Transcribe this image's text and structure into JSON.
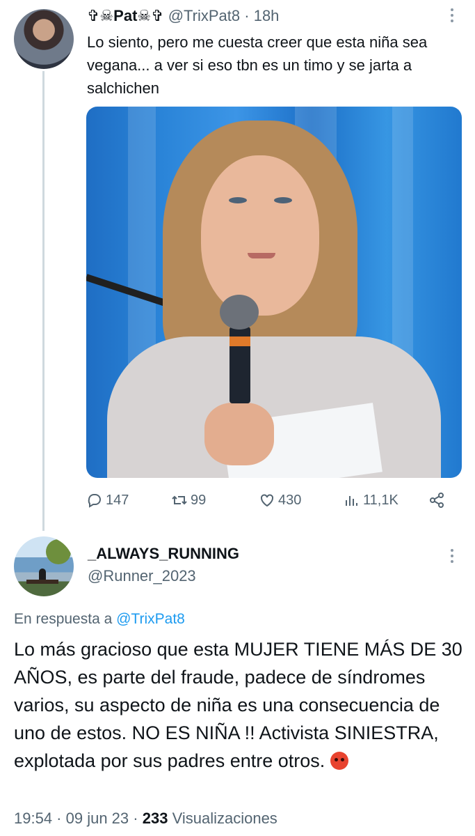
{
  "tweet1": {
    "display_name": "✞☠Pat☠✞",
    "handle": "@TrixPat8",
    "separator": "·",
    "time": "18h",
    "text": "Lo siento, pero me cuesta creer que esta niña sea vegana... a ver si eso tbn es un timo y se jarta a salchichen",
    "actions": {
      "replies": "147",
      "retweets": "99",
      "likes": "430",
      "views": "11,1K"
    }
  },
  "tweet2": {
    "display_name": "_ALWAYS_RUNNING",
    "handle": "@Runner_2023",
    "reply_prefix": "En respuesta a",
    "reply_to": "@TrixPat8",
    "text": "Lo más gracioso que esta MUJER TIENE MÁS DE 30 AÑOS, es parte del fraude, padece de síndromes varios, su aspecto de niña es una consecuencia de uno de estos. NO ES NIÑA !! Activista SINIESTRA, explotada por sus padres entre otros.",
    "time": "19:54",
    "date": "09 jun 23",
    "views_count": "233",
    "views_label": "Visualizaciones",
    "meta_separator": " · "
  },
  "icons": {
    "reply": "reply-icon",
    "retweet": "retweet-icon",
    "like": "heart-icon",
    "views": "views-icon",
    "share": "share-icon",
    "more": "more-vertical-icon",
    "angry_emoji": "angry-face-emoji"
  },
  "colors": {
    "muted_text": "#536471",
    "link": "#1d9bf0",
    "thread_line": "#cfd9de"
  }
}
